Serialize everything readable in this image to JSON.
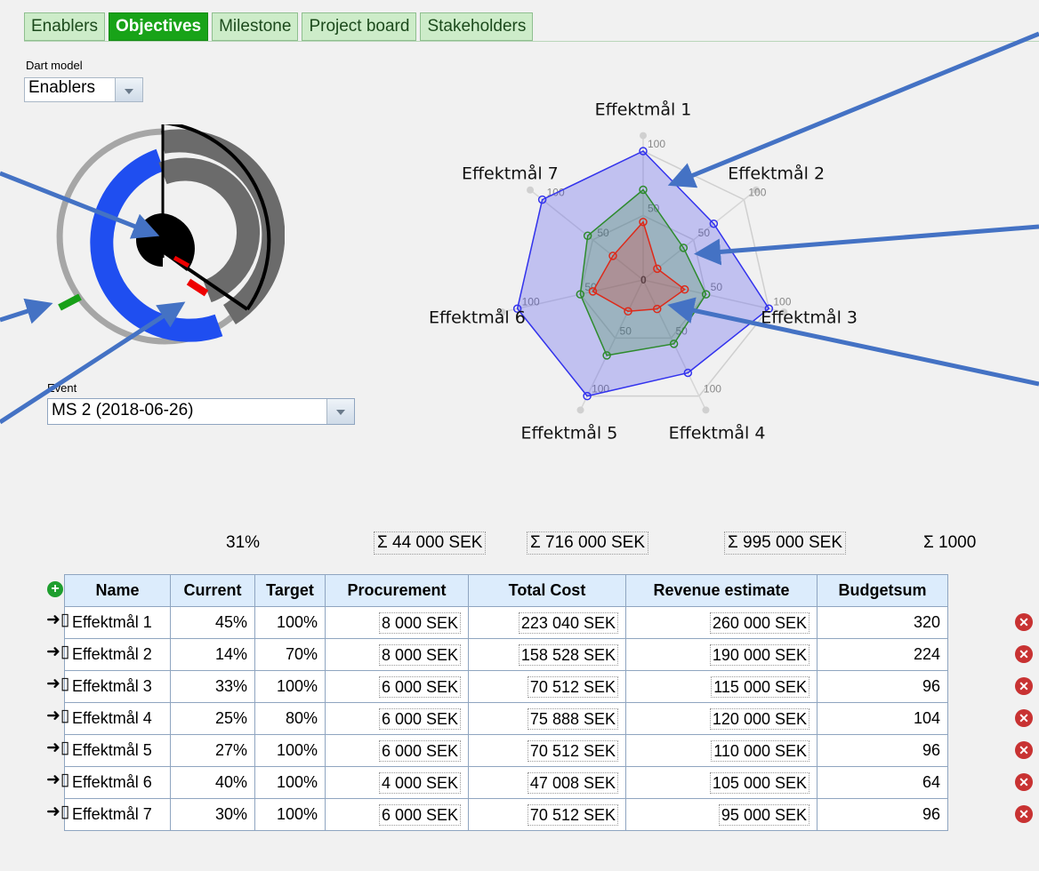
{
  "tabs": [
    {
      "label": "Enablers",
      "active": false
    },
    {
      "label": "Objectives",
      "active": true
    },
    {
      "label": "Milestone",
      "active": false
    },
    {
      "label": "Project board",
      "active": false
    },
    {
      "label": "Stakeholders",
      "active": false
    }
  ],
  "dart_model": {
    "label": "Dart model",
    "value": "Enablers"
  },
  "event": {
    "label": "Event",
    "value": "MS 2 (2018-06-26)"
  },
  "chart_data": {
    "type": "radar",
    "axes": [
      "Effektmål 1",
      "Effektmål 2",
      "Effektmål 3",
      "Effektmål 4",
      "Effektmål 5",
      "Effektmål 6",
      "Effektmål 7"
    ],
    "rlim": [
      0,
      100
    ],
    "ticks": [
      "0",
      "50",
      "100"
    ],
    "series": [
      {
        "values": [
          100,
          70,
          100,
          80,
          100,
          100,
          100
        ],
        "color": "#3333ee"
      },
      {
        "values": [
          70,
          40,
          50,
          55,
          65,
          50,
          55
        ],
        "color": "#2e8b2e"
      },
      {
        "values": [
          45,
          14,
          33,
          25,
          27,
          40,
          30
        ],
        "color": "#dd2a1a"
      }
    ]
  },
  "totals": {
    "current": "31%",
    "procurement": "Σ 44 000 SEK",
    "total_cost": "Σ 716 000 SEK",
    "revenue": "Σ 995 000 SEK",
    "budgetsum": "Σ 1000"
  },
  "table": {
    "headers": [
      "Name",
      "Current",
      "Target",
      "Procurement",
      "Total Cost",
      "Revenue estimate",
      "Budgetsum"
    ],
    "rows": [
      [
        "Effektmål 1",
        "45%",
        "100%",
        "8 000 SEK",
        "223 040 SEK",
        "260 000 SEK",
        "320"
      ],
      [
        "Effektmål 2",
        "14%",
        "70%",
        "8 000 SEK",
        "158 528 SEK",
        "190 000 SEK",
        "224"
      ],
      [
        "Effektmål 3",
        "33%",
        "100%",
        "6 000 SEK",
        "70 512 SEK",
        "115 000 SEK",
        "96"
      ],
      [
        "Effektmål 4",
        "25%",
        "80%",
        "6 000 SEK",
        "75 888 SEK",
        "120 000 SEK",
        "104"
      ],
      [
        "Effektmål 5",
        "27%",
        "100%",
        "6 000 SEK",
        "70 512 SEK",
        "110 000 SEK",
        "96"
      ],
      [
        "Effektmål 6",
        "40%",
        "100%",
        "4 000 SEK",
        "47 008 SEK",
        "105 000 SEK",
        "64"
      ],
      [
        "Effektmål 7",
        "30%",
        "100%",
        "6 000 SEK",
        "70 512 SEK",
        "95 000 SEK",
        "96"
      ]
    ]
  },
  "colors": {
    "tab_active": "#18a318",
    "arrow": "#4472c4",
    "header_bg": "#dcecfc"
  }
}
